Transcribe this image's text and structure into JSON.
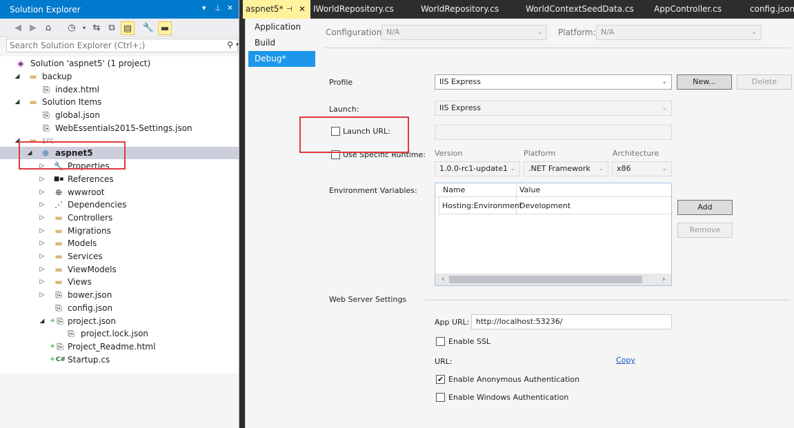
{
  "solution_explorer": {
    "title": "Solution Explorer",
    "search_placeholder": "Search Solution Explorer (Ctrl+;)",
    "tree": [
      {
        "label": "Solution 'aspnet5' (1 project)",
        "icon": "solution-icon"
      },
      {
        "label": "backup",
        "icon": "folder-icon"
      },
      {
        "label": "index.html",
        "icon": "file-icon"
      },
      {
        "label": "Solution Items",
        "icon": "folder-icon"
      },
      {
        "label": "global.json",
        "icon": "json-file-icon"
      },
      {
        "label": "WebEssentials2015-Settings.json",
        "icon": "json-file-icon"
      },
      {
        "label": "src",
        "icon": "folder-icon"
      },
      {
        "label": "aspnet5",
        "icon": "web-project-icon"
      },
      {
        "label": "Properties",
        "icon": "wrench-icon"
      },
      {
        "label": "References",
        "icon": "references-icon"
      },
      {
        "label": "wwwroot",
        "icon": "globe-icon"
      },
      {
        "label": "Dependencies",
        "icon": "dependencies-icon"
      },
      {
        "label": "Controllers",
        "icon": "folder-icon"
      },
      {
        "label": "Migrations",
        "icon": "folder-icon"
      },
      {
        "label": "Models",
        "icon": "folder-icon"
      },
      {
        "label": "Services",
        "icon": "folder-icon"
      },
      {
        "label": "ViewModels",
        "icon": "folder-icon"
      },
      {
        "label": "Views",
        "icon": "folder-icon"
      },
      {
        "label": "bower.json",
        "icon": "json-file-icon"
      },
      {
        "label": "config.json",
        "icon": "json-file-icon"
      },
      {
        "label": "project.json",
        "icon": "json-file-icon"
      },
      {
        "label": "project.lock.json",
        "icon": "lock-json-icon"
      },
      {
        "label": "Project_Readme.html",
        "icon": "html-file-icon"
      },
      {
        "label": "Startup.cs",
        "icon": "csharp-file-icon"
      }
    ]
  },
  "tabs": [
    {
      "label": "aspnet5*"
    },
    {
      "label": "IWorldRepository.cs"
    },
    {
      "label": "WorldRepository.cs"
    },
    {
      "label": "WorldContextSeedData.cs"
    },
    {
      "label": "AppController.cs"
    },
    {
      "label": "config.json"
    }
  ],
  "nav": [
    "Application",
    "Build",
    "Debug*"
  ],
  "top": {
    "configuration_label": "Configuration:",
    "configuration_value": "N/A",
    "platform_label": "Platform:",
    "platform_value": "N/A"
  },
  "debug": {
    "profile_label": "Profile",
    "profile_value": "IIS Express",
    "new_button": "New...",
    "delete_button": "Delete",
    "launch_label": "Launch:",
    "launch_value": "IIS Express",
    "launch_url_label": "Launch URL:",
    "use_runtime_label": "Use Specific Runtime:",
    "version_label": "Version",
    "version_value": "1.0.0-rc1-update1",
    "platform_label": "Platform",
    "platform_value": ".NET Framework",
    "architecture_label": "Architecture",
    "architecture_value": "x86",
    "env_label": "Environment Variables:",
    "env_columns": [
      "Name",
      "Value"
    ],
    "env_rows": [
      {
        "name": "Hosting:Environment",
        "value": "Development"
      }
    ],
    "add_button": "Add",
    "remove_button": "Remove",
    "web_server_label": "Web Server Settings",
    "app_url_label": "App URL:",
    "app_url_value": "http://localhost:53236/",
    "enable_ssl_label": "Enable SSL",
    "url_label": "URL:",
    "copy_link": "Copy",
    "anon_auth_label": "Enable Anonymous Authentication",
    "anon_auth_checked": true,
    "windows_auth_label": "Enable Windows Authentication",
    "windows_auth_checked": false
  },
  "colors": {
    "accent": "#007acc",
    "active_tab": "#fff29d",
    "nav_active": "#1c97ea",
    "annotation": "#e0383b"
  }
}
